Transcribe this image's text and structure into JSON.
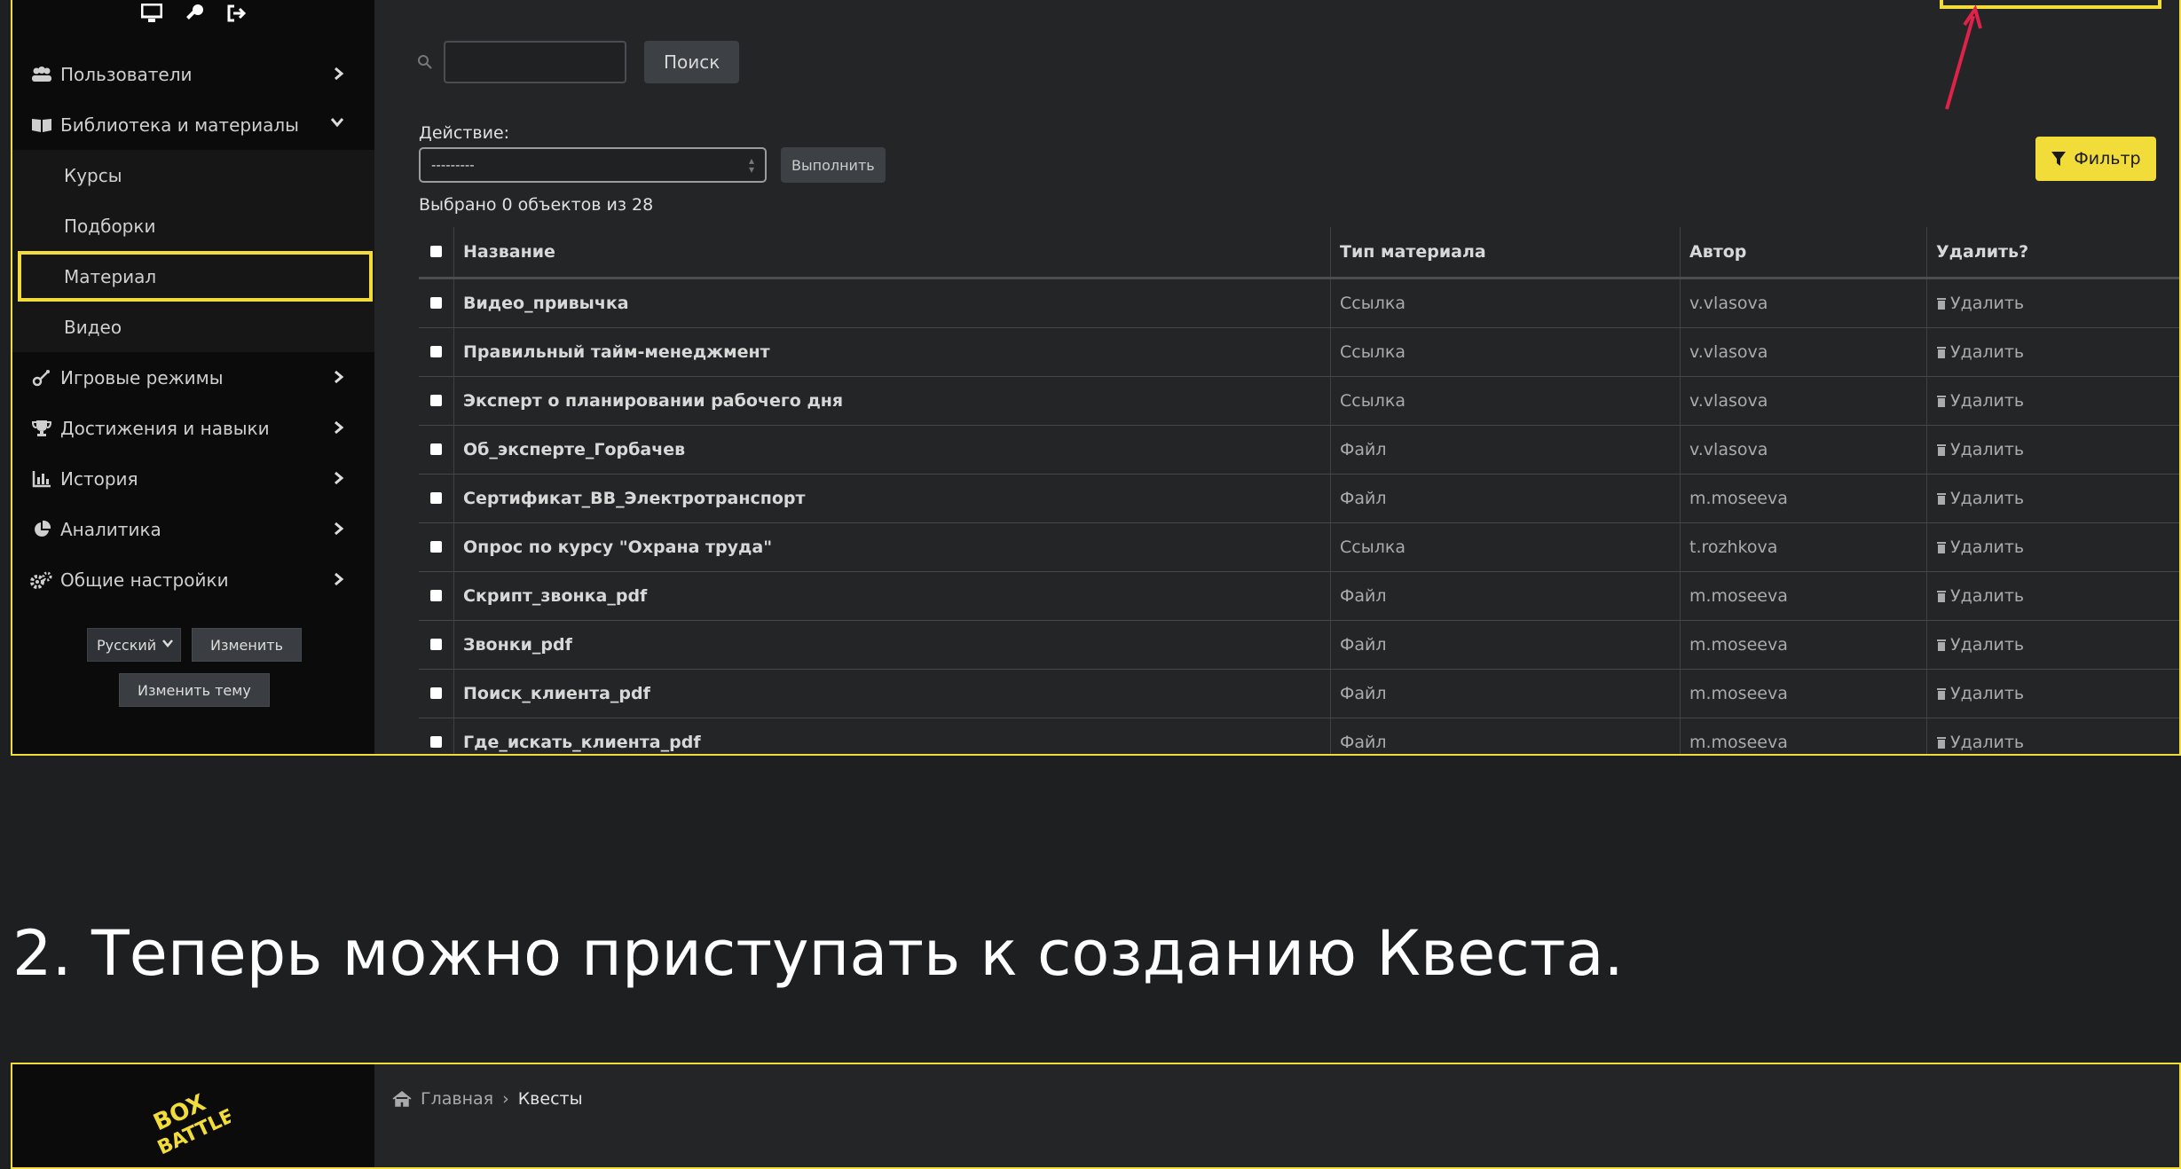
{
  "sidebar": {
    "menu": [
      {
        "label": "Пользователи",
        "icon": "users-icon"
      },
      {
        "label": "Библиотека и материалы",
        "icon": "book-icon"
      }
    ],
    "submenu": [
      "Курсы",
      "Подборки",
      "Материал",
      "Видео"
    ],
    "menu_after": [
      {
        "label": "Игровые режимы",
        "icon": "game-icon"
      },
      {
        "label": "Достижения и навыки",
        "icon": "trophy-icon"
      },
      {
        "label": "История",
        "icon": "chart-icon"
      },
      {
        "label": "Аналитика",
        "icon": "pie-icon"
      },
      {
        "label": "Общие настройки",
        "icon": "gears-icon"
      }
    ],
    "language": "Русский",
    "change_button": "Изменить",
    "theme_button": "Изменить тему"
  },
  "toolbar": {
    "search_button": "Поиск",
    "action_label": "Действие:",
    "action_value": "---------",
    "run_button": "Выполнить",
    "filter_button": "Фильтр",
    "selected_count": "Выбрано 0 объектов из 28"
  },
  "table": {
    "headers": [
      "Название",
      "Тип материала",
      "Автор",
      "Удалить?"
    ],
    "rows": [
      {
        "name": "Видео_привычка",
        "type": "Ссылка",
        "author": "v.vlasova",
        "delete": "Удалить"
      },
      {
        "name": "Правильный тайм-менеджмент",
        "type": "Ссылка",
        "author": "v.vlasova",
        "delete": "Удалить"
      },
      {
        "name": "Эксперт о планировании рабочего дня",
        "type": "Ссылка",
        "author": "v.vlasova",
        "delete": "Удалить"
      },
      {
        "name": "Об_эксперте_Горбачев",
        "type": "Файл",
        "author": "v.vlasova",
        "delete": "Удалить"
      },
      {
        "name": "Сертификат_ВВ_Электротранспорт",
        "type": "Файл",
        "author": "m.moseeva",
        "delete": "Удалить"
      },
      {
        "name": "Опрос по курсу \"Охрана труда\"",
        "type": "Ссылка",
        "author": "t.rozhkova",
        "delete": "Удалить"
      },
      {
        "name": "Скрипт_звонка_pdf",
        "type": "Файл",
        "author": "m.moseeva",
        "delete": "Удалить"
      },
      {
        "name": "Звонки_pdf",
        "type": "Файл",
        "author": "m.moseeva",
        "delete": "Удалить"
      },
      {
        "name": "Поиск_клиента_pdf",
        "type": "Файл",
        "author": "m.moseeva",
        "delete": "Удалить"
      },
      {
        "name": "Где_искать_клиента_pdf",
        "type": "Файл",
        "author": "m.moseeva",
        "delete": "Удалить"
      }
    ]
  },
  "heading": "2. Теперь можно приступать к созданию Квеста.",
  "breadcrumb": {
    "home": "Главная",
    "separator": "›",
    "current": "Квесты"
  },
  "logo_text": "BOX BATTLE",
  "colors": {
    "accent": "#f2dc3a",
    "arrow": "#e0224a"
  }
}
